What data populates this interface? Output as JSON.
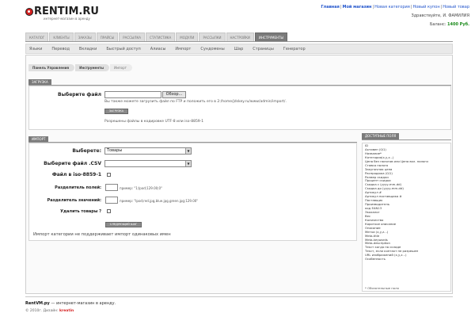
{
  "header": {
    "logo_text": "RENTIM.RU",
    "logo_sub": "интернет-магазин в аренду",
    "toplinks": [
      "Главная",
      "Мой магазин",
      "Новая категория",
      "Новый купон",
      "Новый товар"
    ],
    "hello": "Здравствуйте, И. ФАМИЛИЯ",
    "balance_label": "Баланс:",
    "balance_value": "1400 Руб."
  },
  "mainnav": [
    {
      "label": "Каталог",
      "active": false
    },
    {
      "label": "Клиенты",
      "active": false
    },
    {
      "label": "Заказы",
      "active": false
    },
    {
      "label": "Прайсы",
      "active": false
    },
    {
      "label": "Рассылка",
      "active": false
    },
    {
      "label": "Статистика",
      "active": false
    },
    {
      "label": "Модули",
      "active": false
    },
    {
      "label": "Рассылки",
      "active": false
    },
    {
      "label": "Настройки",
      "active": false
    },
    {
      "label": "Инструменты",
      "active": true
    }
  ],
  "subnav": [
    "Языки",
    "Перевод",
    "Вкладки",
    "Быстрый доступ",
    "Алиасы",
    "Импорт",
    "Сундомены",
    "Шар",
    "Страницы",
    "Генератор"
  ],
  "breadcrumbs": [
    "Панель Управления",
    "Инструменты",
    "Импорт"
  ],
  "upload": {
    "header": "Загрузка",
    "label": "Выберите файл",
    "browse": "Обзор...",
    "ftp_note": "Вы также можете загрузить файл по FTP и положить его в 2:/home/jdskey.ru/www/admin/import/.",
    "submit": "Загрузка",
    "encoding_note": "Разрешены файлы в кодировке UTF-8 или iso-8859-1"
  },
  "import": {
    "header": "Импорт",
    "choose_label": "Выберете:",
    "choose_value": "Товары",
    "csv_label": "Выберите файл .CSV",
    "csv_value": "",
    "iso_label": "Файл в iso-8859-1",
    "field_sep_label": "Разделитель полей:",
    "field_sep_example": "пример: \"1;Ipod;129.00;0\"",
    "value_sep_label": "Разделитель значений:",
    "value_sep_example": "пример: \"Ipod;red.jpg,blue.jpg,green.jpg;129.00\"",
    "delete_label": "Удалить товары ?",
    "next_button": "Следующий шаг",
    "category_note": "Импорт категории не поддерживает импорт одинаковых имен"
  },
  "fields": {
    "header": "Доступные поля",
    "items": [
      "ID",
      "Активен (0/1)",
      "Название*",
      "Категория(x,y,z...)",
      "Цена без налогов или Цена вкл. налоги",
      "Ставка налога",
      "Закупочная цена",
      "Распродажа (0/1)",
      "Размер скидки",
      "Процент скидки",
      "Скидка с (yyyy-mm-dd)",
      "Скидка до (yyyy-mm-dd)",
      "Артикул #",
      "Артикул поставщика #",
      "Поставщик",
      "Производитель",
      "код EAN13",
      "Экохалог",
      "Вес",
      "Количество",
      "Короткое описание",
      "Описание",
      "Метки (x,y,z...)",
      "Meta-title",
      "Meta-keywords",
      "Meta-description",
      "Текст когда на складе",
      "Текст, если контакт не разрешен",
      "URL изображений (x,y,z...)",
      "Особенность"
    ],
    "footnote": "* Обязательные поля"
  },
  "footer": {
    "brand": "RentVM.ру",
    "tagline": " — интернет-магазин в аренду.",
    "copyright": "© 2010г. Дизайн:",
    "designer": "kreatin"
  }
}
